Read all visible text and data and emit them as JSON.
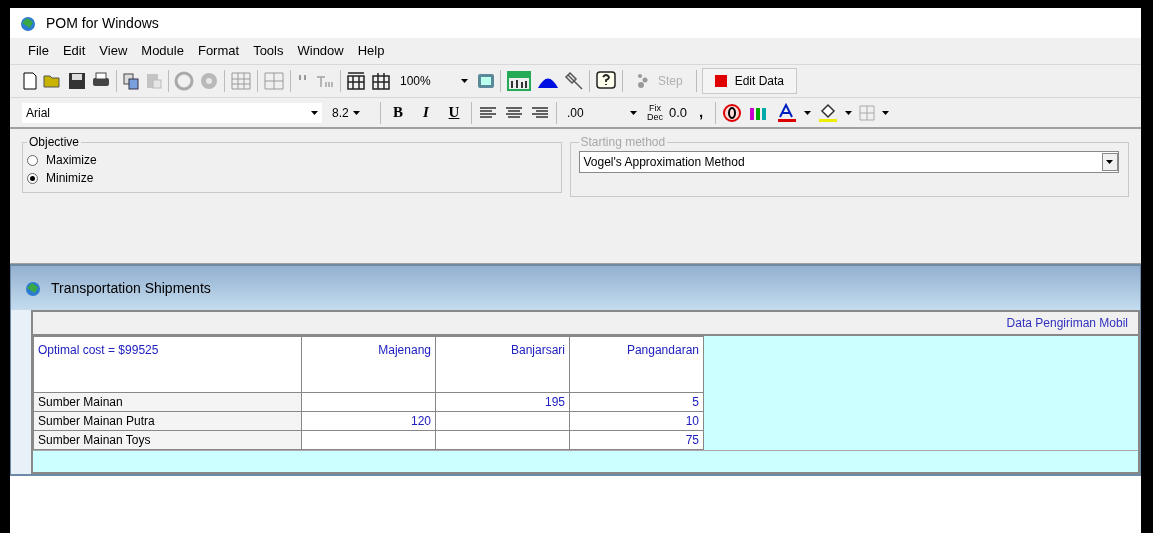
{
  "window": {
    "title": "POM for Windows"
  },
  "menu": [
    "File",
    "Edit",
    "View",
    "Module",
    "Format",
    "Tools",
    "Window",
    "Help"
  ],
  "toolbar": {
    "zoom": "100%",
    "step_button": {
      "label": "Step",
      "disabled": true
    },
    "edit_data_button": {
      "label": "Edit Data"
    }
  },
  "format_bar": {
    "style_buttons": [
      "B",
      "I",
      "U"
    ],
    "font": "Arial",
    "size": "8.2",
    "decimals": ".00",
    "fix_dec": [
      "Fix",
      "Dec"
    ],
    "one_decimal": "0.0",
    "comma": ","
  },
  "objective": {
    "title": "Objective",
    "options": [
      {
        "label": "Maximize",
        "selected": false
      },
      {
        "label": "Minimize",
        "selected": true
      }
    ]
  },
  "starting_method": {
    "title": "Starting method",
    "value": "Vogel's Approximation Method"
  },
  "child_window": {
    "title": "Transportation Shipments",
    "header": "Data Pengiriman Mobil"
  },
  "table": {
    "corner": "Optimal cost = $99525",
    "columns": [
      "Majenang",
      "Banjarsari",
      "Pangandaran"
    ],
    "rows": [
      {
        "name": "Sumber Mainan",
        "cells": [
          "",
          "195",
          "5"
        ]
      },
      {
        "name": "Sumber Mainan Putra",
        "cells": [
          "120",
          "",
          "10"
        ]
      },
      {
        "name": "Sumber Mainan Toys",
        "cells": [
          "",
          "",
          "75"
        ]
      }
    ]
  }
}
